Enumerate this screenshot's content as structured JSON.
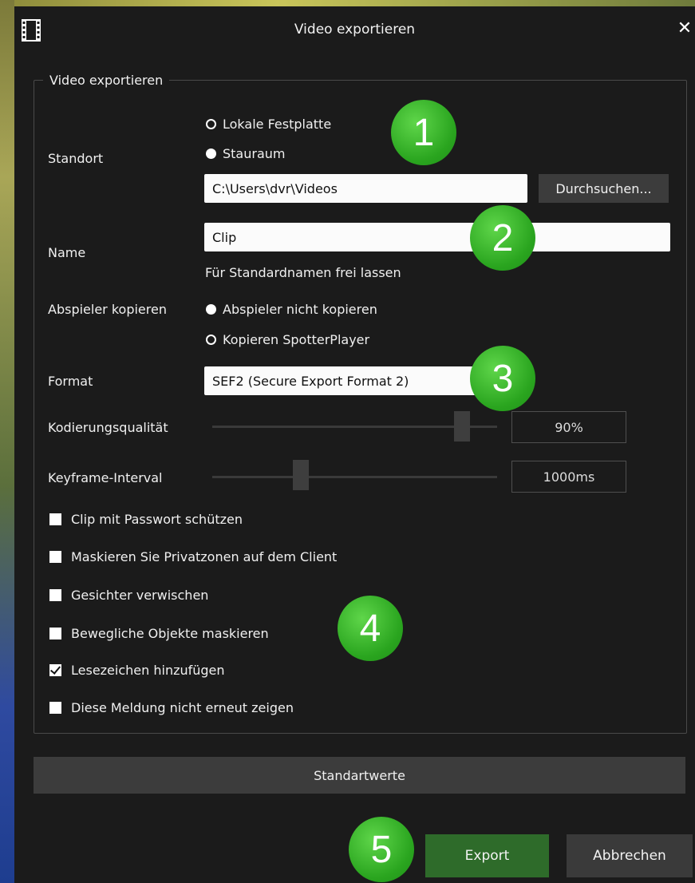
{
  "dialog": {
    "title": "Video exportieren",
    "close_glyph": "✕"
  },
  "group": {
    "legend": "Video exportieren"
  },
  "location": {
    "label": "Standort",
    "options": [
      {
        "label": "Lokale Festplatte",
        "selected": false
      },
      {
        "label": "Stauraum",
        "selected": true
      }
    ],
    "path_value": "C:\\Users\\dvr\\Videos",
    "browse_label": "Durchsuchen..."
  },
  "name": {
    "label": "Name",
    "value": "Clip",
    "hint": "Für Standardnamen frei lassen"
  },
  "player": {
    "label": "Abspieler kopieren",
    "options": [
      {
        "label": "Abspieler nicht kopieren",
        "selected": true
      },
      {
        "label": "Kopieren SpotterPlayer",
        "selected": false
      }
    ]
  },
  "format": {
    "label": "Format",
    "value": "SEF2 (Secure Export Format 2)"
  },
  "quality": {
    "label": "Kodierungsqualität",
    "value_text": "90%",
    "level": 0.9
  },
  "keyframe": {
    "label": "Keyframe-Interval",
    "value_text": "1000ms",
    "level": 0.3
  },
  "checkboxes": [
    {
      "label": "Clip mit Passwort schützen",
      "checked": false
    },
    {
      "label": "Maskieren Sie Privatzonen auf dem Client",
      "checked": false
    },
    {
      "label": "Gesichter verwischen",
      "checked": false
    },
    {
      "label": "Bewegliche Objekte maskieren",
      "checked": false
    },
    {
      "label": "Lesezeichen hinzufügen",
      "checked": true
    },
    {
      "label": "Diese Meldung nicht erneut zeigen",
      "checked": false
    }
  ],
  "buttons": {
    "defaults": "Standartwerte",
    "export": "Export",
    "cancel": "Abbrechen"
  },
  "badges": [
    "1",
    "2",
    "3",
    "4",
    "5"
  ],
  "colors": {
    "accent_badge": "#2aa51f",
    "export_button": "#2e6b2a",
    "dialog_bg": "#1b1b1b"
  },
  "icons": {
    "title": "film-strip-icon",
    "close": "close-icon"
  }
}
